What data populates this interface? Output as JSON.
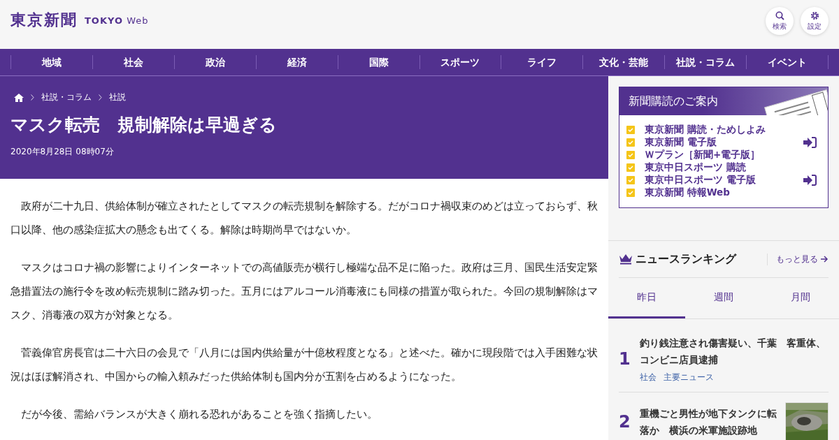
{
  "header": {
    "logo": "東京新聞",
    "logo_sub_bold": "TOKYO",
    "logo_sub": "Web",
    "buttons": [
      {
        "kind": "search",
        "label": "検索"
      },
      {
        "kind": "settings",
        "label": "設定"
      }
    ]
  },
  "nav": [
    "地域",
    "社会",
    "政治",
    "経済",
    "国際",
    "スポーツ",
    "ライフ",
    "文化・芸能",
    "社説・コラム",
    "イベント"
  ],
  "article": {
    "breadcrumb": [
      "社説・コラム",
      "社説"
    ],
    "title": "マスク転売　規制解除は早過ぎる",
    "date": "2020年8月28日 08時07分",
    "paragraphs": [
      "　政府が二十九日、供給体制が確立されたとしてマスクの転売規制を解除する。だがコロナ禍収束のめどは立っておらず、秋口以降、他の感染症拡大の懸念も出てくる。解除は時期尚早ではないか。",
      "　マスクはコロナ禍の影響によりインターネットでの高値販売が横行し極端な品不足に陥った。政府は三月、国民生活安定緊急措置法の施行令を改め転売規制に踏み切った。五月にはアルコール消毒液にも同様の措置が取られた。今回の規制解除はマスク、消毒液の双方が対象となる。",
      "　菅義偉官房長官は二十六日の会見で「八月には国内供給量が十億枚程度となる」と述べた。確かに現段階では入手困難な状況はほぼ解消され、中国からの輸入頼みだった供給体制も国内分が五割を占めるようになった。",
      "　だが今後、需給バランスが大きく崩れる恐れがあることを強く指摘したい。"
    ]
  },
  "subscription": {
    "title": "新聞購読のご案内",
    "items": [
      {
        "label": "東京新聞 購読・ためしよみ",
        "login": false
      },
      {
        "label": "東京新聞 電子版",
        "login": true
      },
      {
        "label": "Ｗプラン［新聞+電子版］",
        "login": false
      },
      {
        "label": "東京中日スポーツ 購読",
        "login": false
      },
      {
        "label": "東京中日スポーツ 電子版",
        "login": true
      },
      {
        "label": "東京新聞 特報Web",
        "login": false
      }
    ]
  },
  "ranking": {
    "title": "ニュースランキング",
    "more": "もっと見る",
    "tabs": [
      {
        "label": "昨日",
        "selected": true
      },
      {
        "label": "週間",
        "selected": false
      },
      {
        "label": "月間",
        "selected": false
      }
    ],
    "items": [
      {
        "rank": "1",
        "title": "釣り銭注意され傷害疑い、千葉　客重体、コンビニ店員逮捕",
        "tags": [
          "社会",
          "主要ニュース"
        ],
        "thumbnail": false
      },
      {
        "rank": "2",
        "title": "重機ごと男性が地下タンクに転落か　横浜の米軍施設跡地",
        "thumbnail": true
      }
    ]
  }
}
